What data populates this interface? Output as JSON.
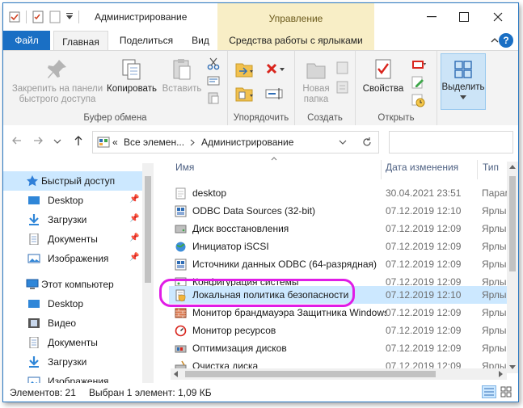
{
  "window": {
    "title": "Администрирование",
    "context_tab_header": "Управление"
  },
  "tabs": [
    {
      "label": "Файл"
    },
    {
      "label": "Главная"
    },
    {
      "label": "Поделиться"
    },
    {
      "label": "Вид"
    },
    {
      "label": "Средства работы с ярлыками"
    }
  ],
  "ribbon": {
    "groups": {
      "clipboard": "Буфер обмена",
      "organize": "Упорядочить",
      "create": "Создать",
      "open": "Открыть"
    },
    "pin_label_1": "Закрепить на панели",
    "pin_label_2": "быстрого доступа",
    "copy_label": "Копировать",
    "paste_label": "Вставить",
    "new_folder_label_1": "Новая",
    "new_folder_label_2": "папка",
    "properties_label": "Свойства",
    "select_label": "Выделить"
  },
  "address": {
    "prefix": "«",
    "crumbs": [
      "Все элемен...",
      "Администрирование"
    ]
  },
  "nav": {
    "quick_access": "Быстрый доступ",
    "quick_items": [
      "Desktop",
      "Загрузки",
      "Документы",
      "Изображения"
    ],
    "this_pc": "Этот компьютер",
    "pc_items": [
      "Desktop",
      "Видео",
      "Документы",
      "Загрузки",
      "Изображения"
    ]
  },
  "columns": {
    "name": "Имя",
    "date": "Дата изменения",
    "type": "Тип"
  },
  "files": [
    {
      "name": "desktop",
      "date": "30.04.2021 23:51",
      "type": "Параметры"
    },
    {
      "name": "ODBC Data Sources (32-bit)",
      "date": "07.12.2019 12:10",
      "type": "Ярлык"
    },
    {
      "name": "Диск восстановления",
      "date": "07.12.2019 12:09",
      "type": "Ярлык"
    },
    {
      "name": "Инициатор iSCSI",
      "date": "07.12.2019 12:09",
      "type": "Ярлык"
    },
    {
      "name": "Источники данных ODBC (64-разрядная)",
      "date": "07.12.2019 12:09",
      "type": "Ярлык"
    },
    {
      "name": "Конфигурация системы",
      "date": "07.12.2019 12:09",
      "type": "Ярлык"
    },
    {
      "name": "Локальная политика безопасности",
      "date": "07.12.2019 12:10",
      "type": "Ярлык"
    },
    {
      "name": "Монитор брандмауэра Защитника Windows",
      "date": "07.12.2019 12:09",
      "type": "Ярлык"
    },
    {
      "name": "Монитор ресурсов",
      "date": "07.12.2019 12:09",
      "type": "Ярлык"
    },
    {
      "name": "Оптимизация дисков",
      "date": "07.12.2019 12:09",
      "type": "Ярлык"
    },
    {
      "name": "Очистка диска",
      "date": "07.12.2019 12:09",
      "type": "Ярлык"
    }
  ],
  "status": {
    "count": "Элементов: 21",
    "selected": "Выбран 1 элемент: 1,09 КБ"
  },
  "colors": {
    "accent": "#1a6fc4",
    "selection": "#cce8ff",
    "context_tab": "#f8eec6",
    "highlight_outline": "#e01ce6"
  }
}
